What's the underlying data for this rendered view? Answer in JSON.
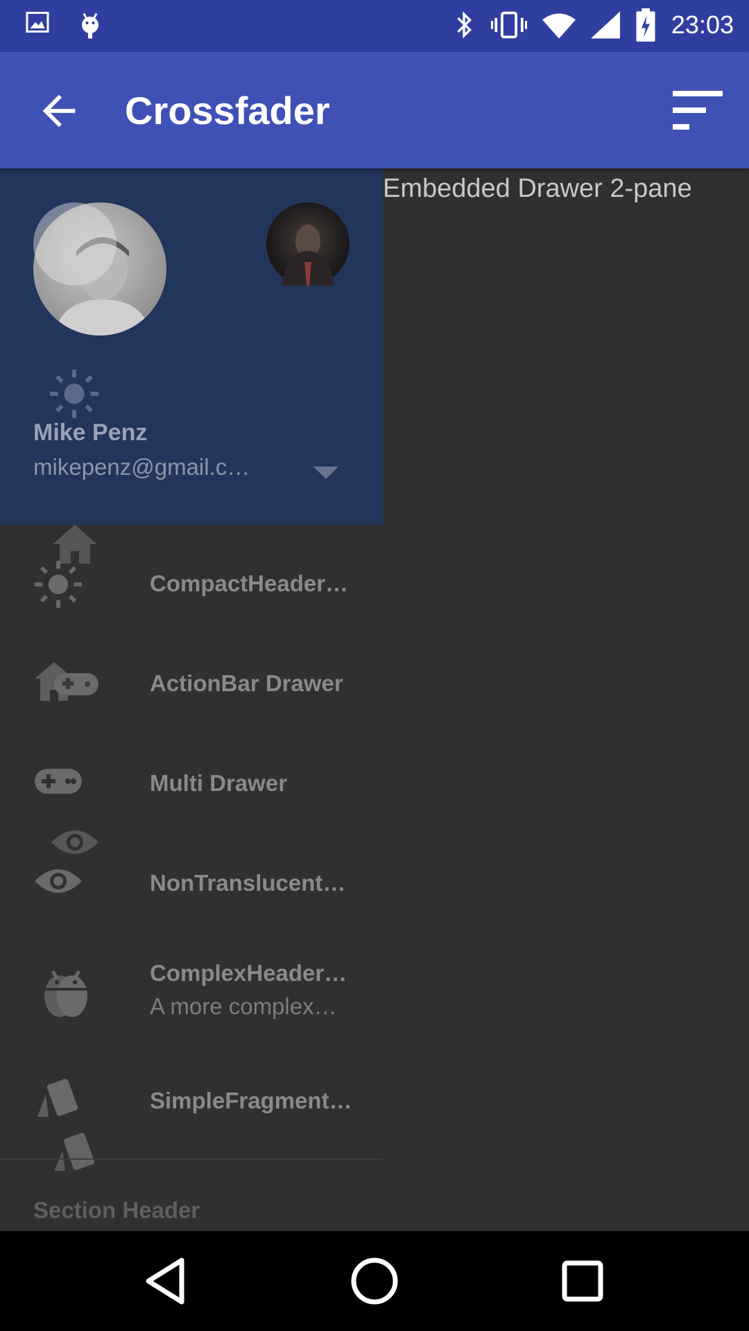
{
  "status_bar": {
    "time": "23:03",
    "icons": [
      "image-icon",
      "android-icon",
      "bluetooth-icon",
      "vibrate-icon",
      "wifi-icon",
      "signal-icon",
      "battery-charging-icon"
    ]
  },
  "toolbar": {
    "title": "Crossfader",
    "back_icon": "arrow-back-icon",
    "menu_icon": "sort-icon"
  },
  "drawer": {
    "header": {
      "name": "Mike Penz",
      "email": "mikepenz@gmail.c…"
    },
    "items": [
      {
        "label": "CompactHeader…",
        "icon": "sun-icon"
      },
      {
        "label": "ActionBar Drawer",
        "icon": "home-gamepad-icon"
      },
      {
        "label": "Multi Drawer",
        "icon": "gamepad-icon"
      },
      {
        "label": "NonTranslucent…",
        "icon": "eye-icon"
      },
      {
        "label": "ComplexHeader…",
        "description": "A more complex…",
        "icon": "android-icon"
      },
      {
        "label": "SimpleFragment…",
        "icon": "cards-icon"
      }
    ],
    "section_header": "Section Header"
  },
  "content": {
    "text": "Embedded Drawer 2-pane"
  },
  "colors": {
    "status_bar": "#303f9f",
    "toolbar": "#3f51b5",
    "drawer_header": "#21365a",
    "background": "#303030"
  }
}
